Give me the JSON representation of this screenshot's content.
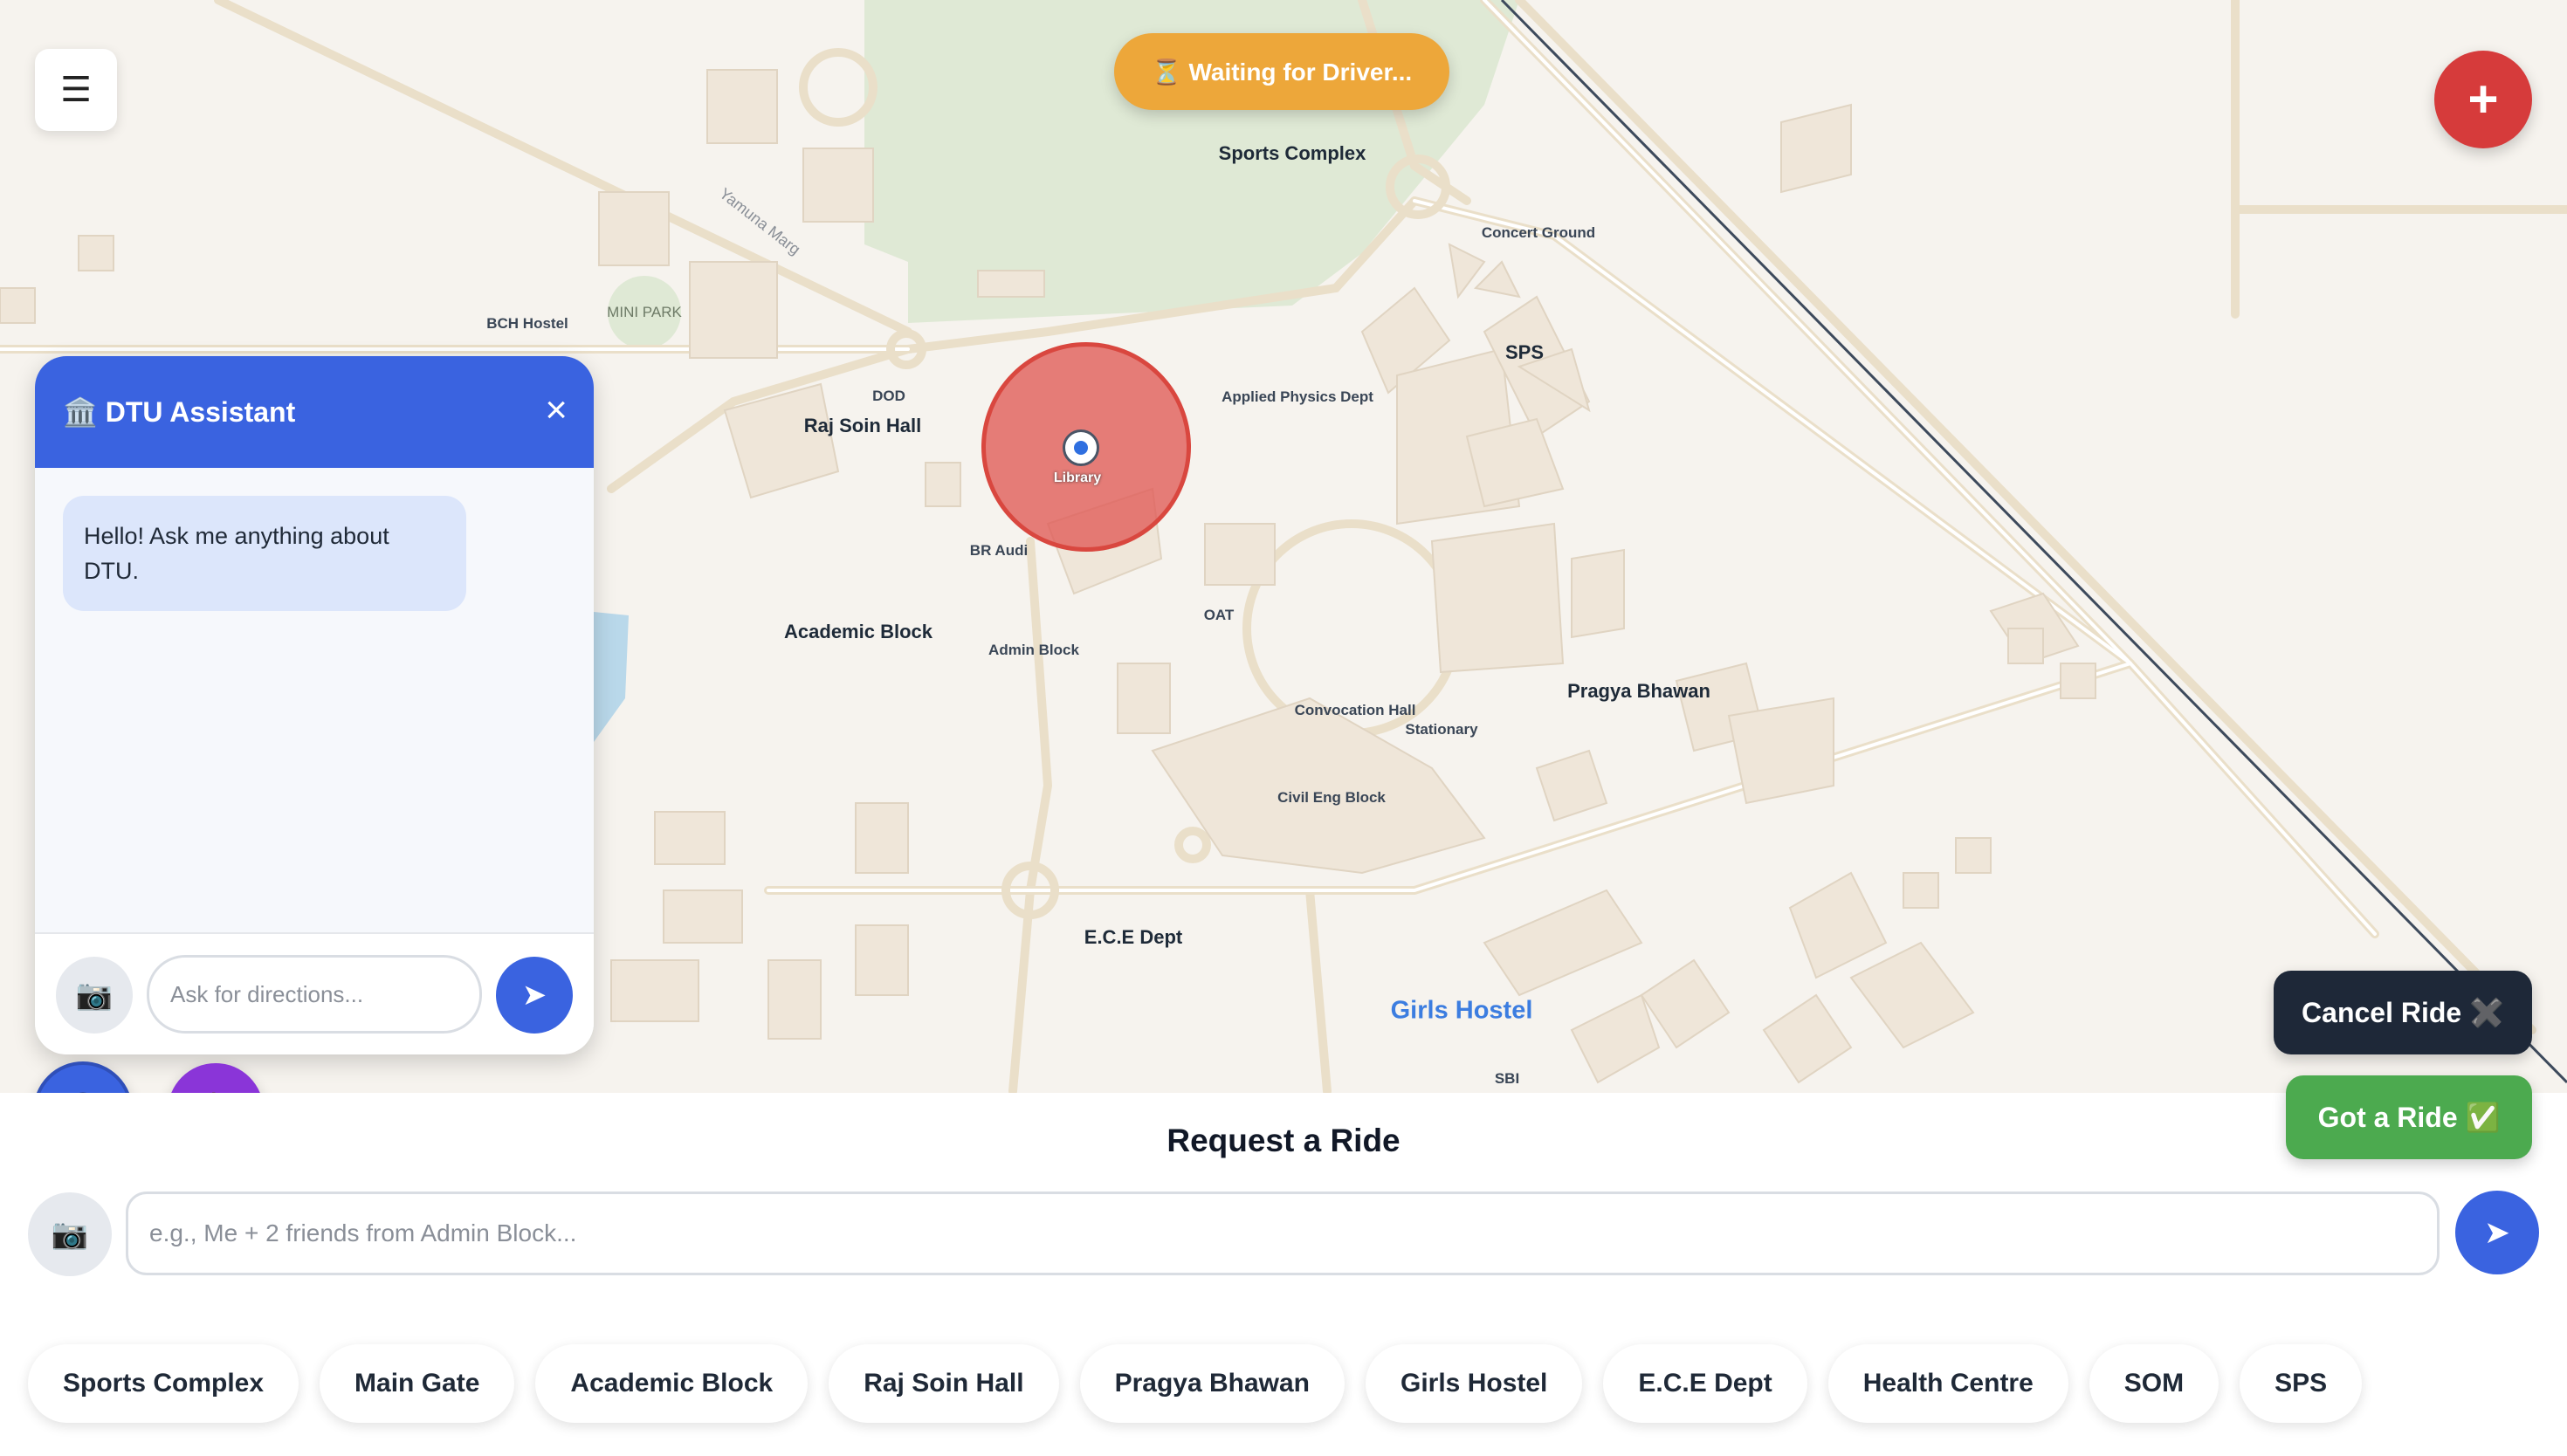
{
  "header": {
    "menu_icon": "hamburger-icon",
    "status": "⏳ Waiting for Driver...",
    "add_icon": "plus-icon"
  },
  "map": {
    "labels": {
      "sports_complex": "Sports Complex",
      "concert_ground": "Concert Ground",
      "sps": "SPS",
      "bch_hostel": "BCH Hostel",
      "mini_park": "MINI PARK",
      "yamuna_marg": "Yamuna Marg",
      "dod": "DOD",
      "raj_soin_hall": "Raj Soin Hall",
      "applied_physics": "Applied Physics Dept",
      "br_audi": "BR Audi",
      "academic_block": "Academic Block",
      "admin_block": "Admin Block",
      "oat": "OAT",
      "convocation_hall": "Convocation Hall",
      "stationary": "Stationary",
      "pragya_bhawan": "Pragya Bhawan",
      "civil_eng_block": "Civil Eng Block",
      "ece_dept": "E.C.E Dept",
      "girls_hostel": "Girls Hostel",
      "sbi": "SBI"
    },
    "marker": {
      "label": "Library",
      "color": "#e05a56"
    }
  },
  "chat": {
    "title": "🏛️ DTU Assistant",
    "close_icon": "close-icon",
    "message": "Hello! Ask me anything about DTU.",
    "input_placeholder": "Ask for directions...",
    "camera_icon": "📷",
    "send_icon": "➤",
    "accent_color": "#3a63e0"
  },
  "fabs": {
    "chat_icon": "💬",
    "walk_icon": "🚶"
  },
  "ride_actions": {
    "cancel_label": "Cancel Ride ✖️",
    "got_ride_label": "Got a Ride ✅"
  },
  "ride_request": {
    "title": "Request a Ride",
    "placeholder": "e.g., Me + 2 friends from Admin Block...",
    "camera_icon": "📷",
    "send_icon": "➤"
  },
  "quick_locations": [
    "Sports Complex",
    "Main Gate",
    "Academic Block",
    "Raj Soin Hall",
    "Pragya Bhawan",
    "Girls Hostel",
    "E.C.E Dept",
    "Health Centre",
    "SOM",
    "SPS"
  ]
}
